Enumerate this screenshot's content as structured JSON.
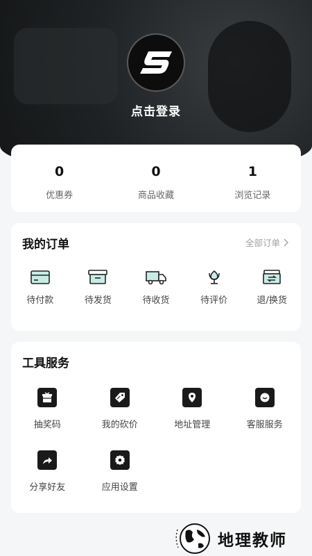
{
  "profile": {
    "login_label": "点击登录",
    "logo_letter": "S"
  },
  "stats": [
    {
      "value": "0",
      "label": "优惠券"
    },
    {
      "value": "0",
      "label": "商品收藏"
    },
    {
      "value": "1",
      "label": "浏览记录"
    }
  ],
  "orders": {
    "title": "我的订单",
    "all_label": "全部订单",
    "items": [
      {
        "label": "待付款",
        "icon": "card-icon"
      },
      {
        "label": "待发货",
        "icon": "box-icon"
      },
      {
        "label": "待收货",
        "icon": "truck-icon"
      },
      {
        "label": "待评价",
        "icon": "flower-icon"
      },
      {
        "label": "退/换货",
        "icon": "exchange-icon"
      }
    ]
  },
  "tools": {
    "title": "工具服务",
    "items": [
      {
        "label": "抽奖码",
        "icon": "gift-icon"
      },
      {
        "label": "我的砍价",
        "icon": "tag-icon"
      },
      {
        "label": "地址管理",
        "icon": "location-icon"
      },
      {
        "label": "客服服务",
        "icon": "chat-icon"
      },
      {
        "label": "分享好友",
        "icon": "share-icon"
      },
      {
        "label": "应用设置",
        "icon": "settings-icon"
      }
    ]
  },
  "watermark": {
    "text": "地理教师"
  },
  "colors": {
    "accent": "#3fb8a8",
    "dark": "#1a1a1a",
    "background": "#f5f6f7"
  }
}
